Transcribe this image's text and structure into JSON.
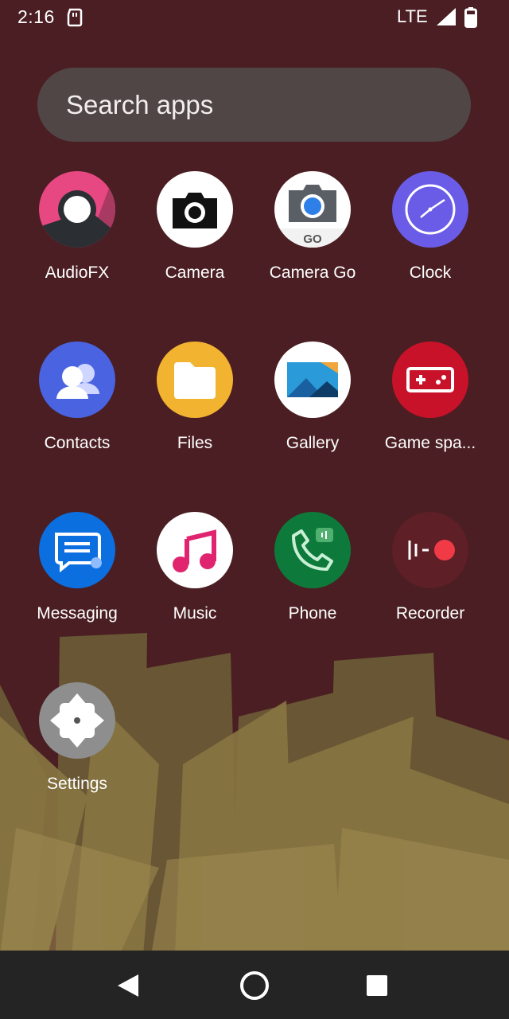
{
  "status_bar": {
    "time": "2:16",
    "network": "LTE",
    "icons": [
      "sd-card-icon",
      "signal-icon",
      "battery-icon"
    ]
  },
  "search": {
    "placeholder": "Search apps"
  },
  "apps": [
    {
      "label": "AudioFX",
      "icon": "audiofx-icon"
    },
    {
      "label": "Camera",
      "icon": "camera-icon"
    },
    {
      "label": "Camera Go",
      "icon": "camera-go-icon",
      "badge_text": "GO"
    },
    {
      "label": "Clock",
      "icon": "clock-icon"
    },
    {
      "label": "Contacts",
      "icon": "contacts-icon"
    },
    {
      "label": "Files",
      "icon": "files-icon"
    },
    {
      "label": "Gallery",
      "icon": "gallery-icon"
    },
    {
      "label": "Game spa...",
      "icon": "game-space-icon"
    },
    {
      "label": "Messaging",
      "icon": "messaging-icon"
    },
    {
      "label": "Music",
      "icon": "music-icon"
    },
    {
      "label": "Phone",
      "icon": "phone-icon"
    },
    {
      "label": "Recorder",
      "icon": "recorder-icon"
    },
    {
      "label": "Settings",
      "icon": "settings-icon"
    }
  ],
  "nav_bar": {
    "icons": [
      "back-icon",
      "home-icon",
      "recents-icon"
    ]
  },
  "colors": {
    "wallpaper_top": "#4a1e22",
    "wallpaper_bottom": "#7a6a36",
    "search_bar": "#504a4a",
    "nav_bar": "#242424"
  }
}
